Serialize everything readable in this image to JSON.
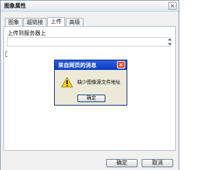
{
  "window": {
    "title": "图象属性",
    "close_glyph": "×"
  },
  "tabs": [
    {
      "label": "图象"
    },
    {
      "label": "超链接"
    },
    {
      "label": "上传"
    },
    {
      "label": "高级"
    }
  ],
  "active_tab": "上传",
  "upload": {
    "label": "上传到服务器上",
    "file_value": ""
  },
  "alert": {
    "title": "来自网页的消息",
    "close_glyph": "×",
    "icon": "warning-icon",
    "message": "缺少图像源文件地址",
    "ok_label": "确定"
  },
  "footer": {
    "ok_label": "确定",
    "cancel_label": "取消"
  },
  "colors": {
    "alert_titlebar": "#0a3cc0",
    "alert_close": "#e14b23",
    "warning_yellow": "#f7d21c"
  }
}
